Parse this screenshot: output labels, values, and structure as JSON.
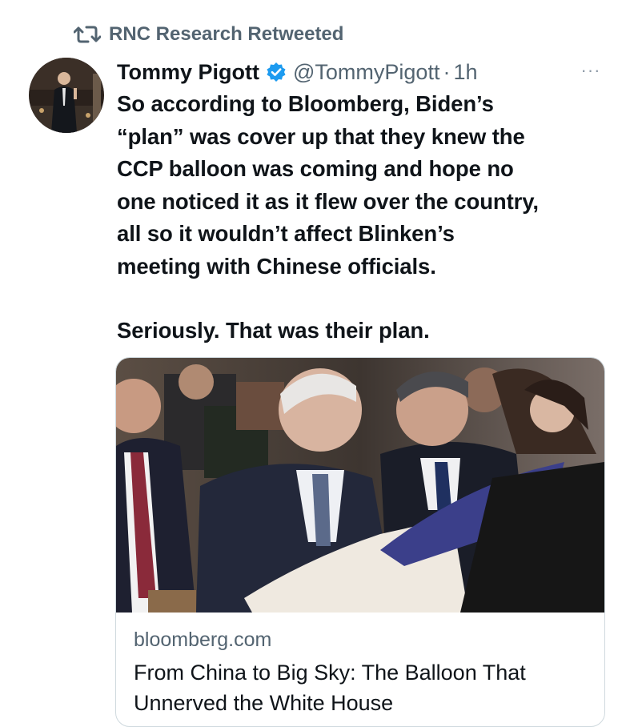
{
  "retweet": {
    "icon": "retweet-icon",
    "label": "RNC Research Retweeted"
  },
  "tweet": {
    "author_name": "Tommy Pigott",
    "verified_icon": "verified-badge-icon",
    "handle": "@TommyPigott",
    "separator": "·",
    "time": "1h",
    "more_icon": "more-options-icon",
    "more_label": "···",
    "paragraphs": [
      "So according to Bloomberg, Biden’s\n“plan” was cover up that they knew the\nCCP balloon was coming and hope no\none noticed it as it flew over the country,\nall so it wouldn’t affect Blinken’s\nmeeting with Chinese officials.",
      "Seriously. That was their plan."
    ]
  },
  "card": {
    "domain": "bloomberg.com",
    "title": "From China to Big Sky: The Balloon That Unnerved the White House"
  },
  "colors": {
    "text": "#0f1419",
    "muted": "#536471",
    "verified": "#1d9bf0",
    "border": "#cfd9de"
  }
}
